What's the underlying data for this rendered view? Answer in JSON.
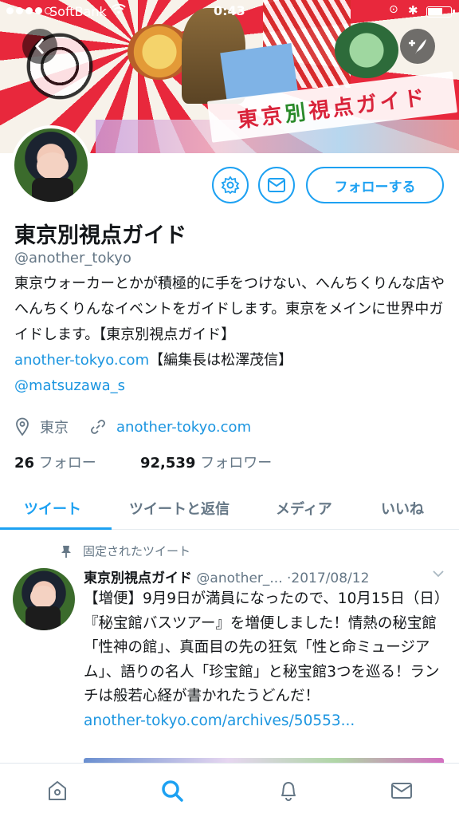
{
  "status_bar": {
    "carrier": "SoftBank",
    "time": "0:43"
  },
  "banner": {
    "title_left": "東京",
    "title_mid": "別",
    "title_right": "視点ガイド"
  },
  "profile": {
    "name": "東京別視点ガイド",
    "handle": "@another_tokyo",
    "bio_text": "東京ウォーカーとかが積極的に手をつけない、へんちくりんな店やへんちくりんなイベントをガイドします。東京をメインに世界中ガイドします。【東京別視点ガイド】",
    "bio_link": "another-tokyo.com",
    "bio_after_link": "【編集長は松澤茂信】",
    "bio_mention": "@matsuzawa_s",
    "location": "東京",
    "website": "another-tokyo.com",
    "following_count": "26",
    "following_label": "フォロー",
    "followers_count": "92,539",
    "followers_label": "フォロワー",
    "follow_button": "フォローする"
  },
  "tabs": [
    {
      "label": "ツイート"
    },
    {
      "label": "ツイートと返信"
    },
    {
      "label": "メディア"
    },
    {
      "label": "いいね"
    }
  ],
  "tweet": {
    "pinned_label": "固定されたツイート",
    "author_name": "東京別視点ガイド",
    "author_handle": "@another_...",
    "date": "·2017/08/12",
    "text": "【増便】9月9日が満員になったので、10月15日（日）『秘宝館バスツアー』を増便しました！情熱の秘宝館「性神の館」、真面目の先の狂気「性と命ミュージアム」、語りの名人「珍宝館」と秘宝館3つを巡る！ランチは般若心経が書かれたうどんだ！",
    "link": "another-tokyo.com/archives/50553..."
  },
  "colors": {
    "accent": "#1da1f2",
    "link": "#1b95e0",
    "secondary_text": "#657786"
  },
  "bottom_nav": [
    "home-icon",
    "search-icon",
    "notifications-icon",
    "messages-icon"
  ]
}
